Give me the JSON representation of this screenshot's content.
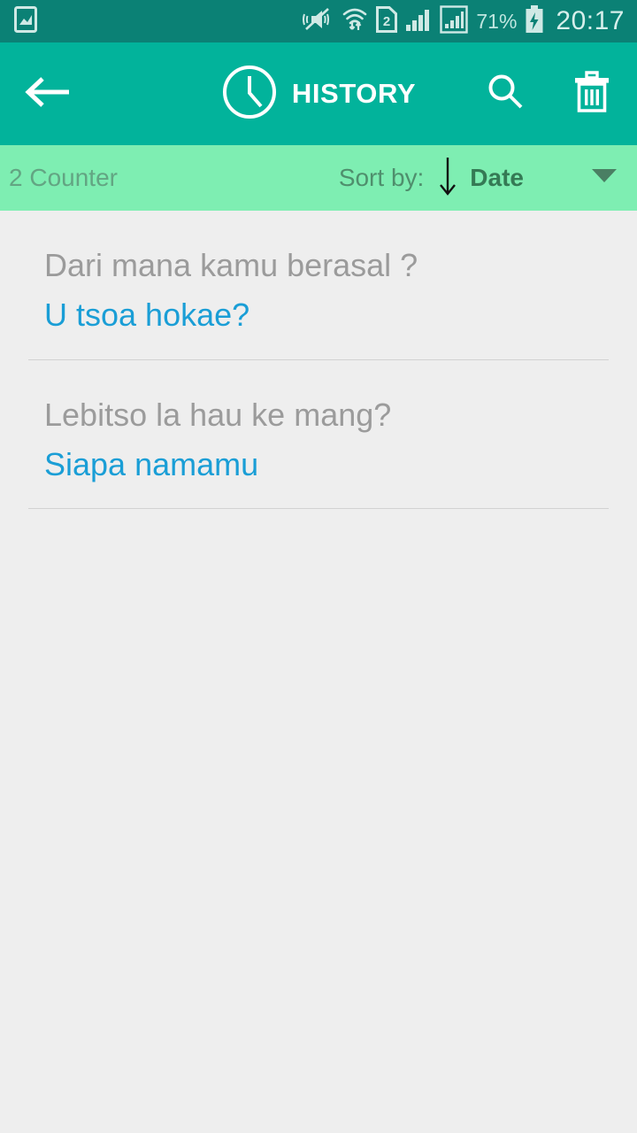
{
  "status_bar": {
    "background": "#0b8175",
    "notification_icon": "image-notification-icon",
    "icons": [
      "vibrate-mute-icon",
      "wifi-transfer-icon",
      "sim2-icon",
      "signal-bars-icon",
      "signal-bars-boxed-icon"
    ],
    "battery_percent": "71%",
    "battery_icon": "battery-charging-icon",
    "clock": "20:17"
  },
  "app_bar": {
    "background": "#02b39b",
    "back_icon": "arrow-left-icon",
    "title_icon": "clock-icon",
    "title": "HISTORY",
    "search_icon": "search-icon",
    "delete_icon": "trash-icon"
  },
  "sort_bar": {
    "background": "#7eeeb2",
    "counter": "2 Counter",
    "sort_by_label": "Sort by:",
    "sort_direction_icon": "arrow-down-icon",
    "sort_value": "Date",
    "dropdown_icon": "caret-down-icon"
  },
  "history": {
    "items": [
      {
        "source": "Dari mana kamu berasal ?",
        "target": "U tsoa hokae?"
      },
      {
        "source": "Lebitso la hau ke mang?",
        "target": "Siapa namamu"
      }
    ]
  },
  "colors": {
    "status_bar": "#0b8175",
    "app_bar": "#02b39b",
    "sort_bar": "#7eeeb2",
    "body": "#eeeeee",
    "source_text": "#9b9b9b",
    "target_text": "#1a9ed6"
  }
}
